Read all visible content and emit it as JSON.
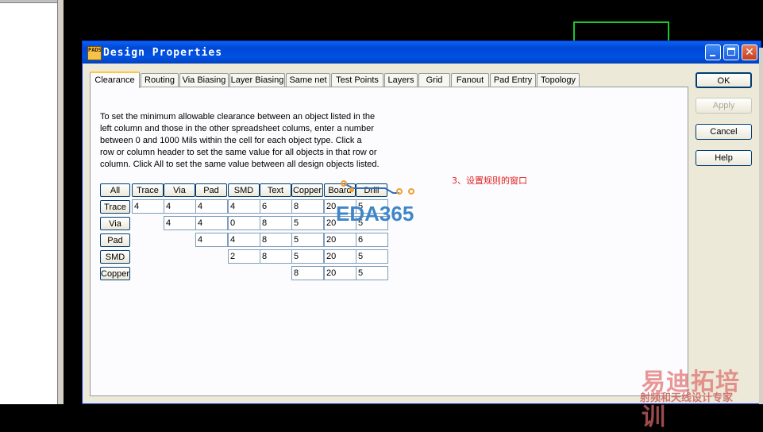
{
  "window": {
    "title": "Design Properties",
    "icon_text": "PADS"
  },
  "tabs": [
    {
      "label": "Clearance",
      "active": true
    },
    {
      "label": "Routing"
    },
    {
      "label": "Via Biasing"
    },
    {
      "label": "Layer Biasing"
    },
    {
      "label": "Same net"
    },
    {
      "label": "Test Points"
    },
    {
      "label": "Layers"
    },
    {
      "label": "Grid"
    },
    {
      "label": "Fanout"
    },
    {
      "label": "Pad Entry"
    },
    {
      "label": "Topology"
    }
  ],
  "instructions": [
    "To set the minimum allowable clearance between an object listed in the",
    "left column and those in the other spreadsheet colums, enter a number",
    "between 0 and 1000 Mils within the cell for each object type. Click a",
    "row or column header to set the same value for all objects in that row or",
    "column. Click All to set the same value between all design objects listed."
  ],
  "grid": {
    "all_label": "All",
    "columns": [
      "Trace",
      "Via",
      "Pad",
      "SMD",
      "Text",
      "Copper",
      "Board",
      "Drill"
    ],
    "rows": [
      {
        "label": "Trace",
        "cells": [
          "4",
          "4",
          "4",
          "4",
          "6",
          "8",
          "20",
          "5"
        ]
      },
      {
        "label": "Via",
        "cells": [
          "",
          "4",
          "4",
          "0",
          "8",
          "5",
          "20",
          "5"
        ]
      },
      {
        "label": "Pad",
        "cells": [
          "",
          "",
          "4",
          "4",
          "8",
          "5",
          "20",
          "6"
        ]
      },
      {
        "label": "SMD",
        "cells": [
          "",
          "",
          "",
          "2",
          "8",
          "5",
          "20",
          "5"
        ]
      },
      {
        "label": "Copper",
        "cells": [
          "",
          "",
          "",
          "",
          "",
          "8",
          "20",
          "5"
        ]
      }
    ]
  },
  "buttons": {
    "ok": "OK",
    "apply": "Apply",
    "cancel": "Cancel",
    "help": "Help"
  },
  "annotation": "3、设置规则的窗口",
  "watermark": {
    "eda": "EDA365",
    "brand": "易迪拓培训",
    "brand_sub": "射频和天线设计专家"
  },
  "colors": {
    "titlebar": "#0052e4",
    "annotation": "#e02020",
    "green_rect": "#19c92c",
    "watermark": "#3f86c8"
  }
}
